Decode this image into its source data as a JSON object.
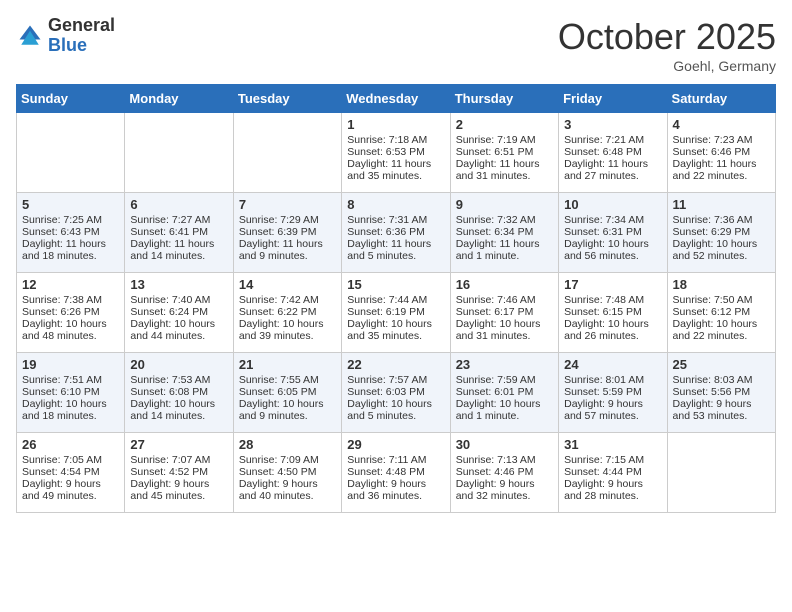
{
  "logo": {
    "general": "General",
    "blue": "Blue"
  },
  "title": "October 2025",
  "location": "Goehl, Germany",
  "headers": [
    "Sunday",
    "Monday",
    "Tuesday",
    "Wednesday",
    "Thursday",
    "Friday",
    "Saturday"
  ],
  "weeks": [
    [
      {
        "day": "",
        "content": ""
      },
      {
        "day": "",
        "content": ""
      },
      {
        "day": "",
        "content": ""
      },
      {
        "day": "1",
        "content": "Sunrise: 7:18 AM\nSunset: 6:53 PM\nDaylight: 11 hours and 35 minutes."
      },
      {
        "day": "2",
        "content": "Sunrise: 7:19 AM\nSunset: 6:51 PM\nDaylight: 11 hours and 31 minutes."
      },
      {
        "day": "3",
        "content": "Sunrise: 7:21 AM\nSunset: 6:48 PM\nDaylight: 11 hours and 27 minutes."
      },
      {
        "day": "4",
        "content": "Sunrise: 7:23 AM\nSunset: 6:46 PM\nDaylight: 11 hours and 22 minutes."
      }
    ],
    [
      {
        "day": "5",
        "content": "Sunrise: 7:25 AM\nSunset: 6:43 PM\nDaylight: 11 hours and 18 minutes."
      },
      {
        "day": "6",
        "content": "Sunrise: 7:27 AM\nSunset: 6:41 PM\nDaylight: 11 hours and 14 minutes."
      },
      {
        "day": "7",
        "content": "Sunrise: 7:29 AM\nSunset: 6:39 PM\nDaylight: 11 hours and 9 minutes."
      },
      {
        "day": "8",
        "content": "Sunrise: 7:31 AM\nSunset: 6:36 PM\nDaylight: 11 hours and 5 minutes."
      },
      {
        "day": "9",
        "content": "Sunrise: 7:32 AM\nSunset: 6:34 PM\nDaylight: 11 hours and 1 minute."
      },
      {
        "day": "10",
        "content": "Sunrise: 7:34 AM\nSunset: 6:31 PM\nDaylight: 10 hours and 56 minutes."
      },
      {
        "day": "11",
        "content": "Sunrise: 7:36 AM\nSunset: 6:29 PM\nDaylight: 10 hours and 52 minutes."
      }
    ],
    [
      {
        "day": "12",
        "content": "Sunrise: 7:38 AM\nSunset: 6:26 PM\nDaylight: 10 hours and 48 minutes."
      },
      {
        "day": "13",
        "content": "Sunrise: 7:40 AM\nSunset: 6:24 PM\nDaylight: 10 hours and 44 minutes."
      },
      {
        "day": "14",
        "content": "Sunrise: 7:42 AM\nSunset: 6:22 PM\nDaylight: 10 hours and 39 minutes."
      },
      {
        "day": "15",
        "content": "Sunrise: 7:44 AM\nSunset: 6:19 PM\nDaylight: 10 hours and 35 minutes."
      },
      {
        "day": "16",
        "content": "Sunrise: 7:46 AM\nSunset: 6:17 PM\nDaylight: 10 hours and 31 minutes."
      },
      {
        "day": "17",
        "content": "Sunrise: 7:48 AM\nSunset: 6:15 PM\nDaylight: 10 hours and 26 minutes."
      },
      {
        "day": "18",
        "content": "Sunrise: 7:50 AM\nSunset: 6:12 PM\nDaylight: 10 hours and 22 minutes."
      }
    ],
    [
      {
        "day": "19",
        "content": "Sunrise: 7:51 AM\nSunset: 6:10 PM\nDaylight: 10 hours and 18 minutes."
      },
      {
        "day": "20",
        "content": "Sunrise: 7:53 AM\nSunset: 6:08 PM\nDaylight: 10 hours and 14 minutes."
      },
      {
        "day": "21",
        "content": "Sunrise: 7:55 AM\nSunset: 6:05 PM\nDaylight: 10 hours and 9 minutes."
      },
      {
        "day": "22",
        "content": "Sunrise: 7:57 AM\nSunset: 6:03 PM\nDaylight: 10 hours and 5 minutes."
      },
      {
        "day": "23",
        "content": "Sunrise: 7:59 AM\nSunset: 6:01 PM\nDaylight: 10 hours and 1 minute."
      },
      {
        "day": "24",
        "content": "Sunrise: 8:01 AM\nSunset: 5:59 PM\nDaylight: 9 hours and 57 minutes."
      },
      {
        "day": "25",
        "content": "Sunrise: 8:03 AM\nSunset: 5:56 PM\nDaylight: 9 hours and 53 minutes."
      }
    ],
    [
      {
        "day": "26",
        "content": "Sunrise: 7:05 AM\nSunset: 4:54 PM\nDaylight: 9 hours and 49 minutes."
      },
      {
        "day": "27",
        "content": "Sunrise: 7:07 AM\nSunset: 4:52 PM\nDaylight: 9 hours and 45 minutes."
      },
      {
        "day": "28",
        "content": "Sunrise: 7:09 AM\nSunset: 4:50 PM\nDaylight: 9 hours and 40 minutes."
      },
      {
        "day": "29",
        "content": "Sunrise: 7:11 AM\nSunset: 4:48 PM\nDaylight: 9 hours and 36 minutes."
      },
      {
        "day": "30",
        "content": "Sunrise: 7:13 AM\nSunset: 4:46 PM\nDaylight: 9 hours and 32 minutes."
      },
      {
        "day": "31",
        "content": "Sunrise: 7:15 AM\nSunset: 4:44 PM\nDaylight: 9 hours and 28 minutes."
      },
      {
        "day": "",
        "content": ""
      }
    ]
  ]
}
